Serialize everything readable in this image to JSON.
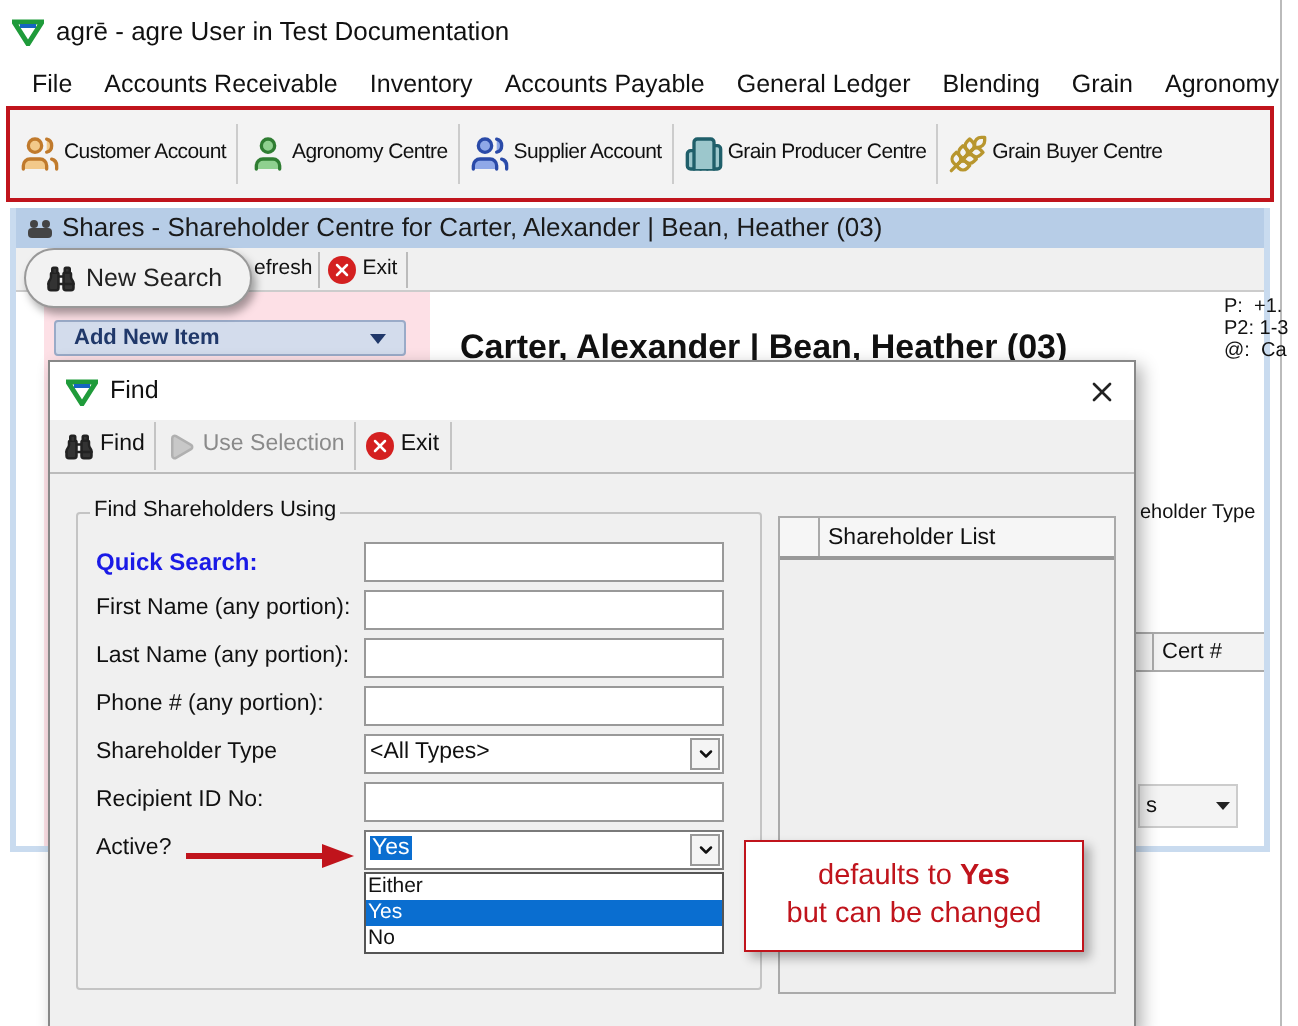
{
  "app": {
    "title": "agrē - agre User in Test Documentation"
  },
  "menu": [
    {
      "label": "File"
    },
    {
      "label": "Accounts Receivable"
    },
    {
      "label": "Inventory"
    },
    {
      "label": "Accounts Payable"
    },
    {
      "label": "General Ledger"
    },
    {
      "label": "Blending"
    },
    {
      "label": "Grain"
    },
    {
      "label": "Agronomy"
    }
  ],
  "toolbar": [
    {
      "label": "Customer Account",
      "kind": "customers"
    },
    {
      "label": "Agronomy Centre",
      "kind": "farmer"
    },
    {
      "label": "Supplier Account",
      "kind": "suppliers"
    },
    {
      "label": "Grain Producer Centre",
      "kind": "producer"
    },
    {
      "label": "Grain Buyer Centre",
      "kind": "buyer"
    }
  ],
  "shares_window": {
    "title": "Shares - Shareholder Centre for Carter, Alexander | Bean, Heather (03)",
    "toolbar": [
      "efresh",
      "Exit"
    ],
    "add_new_item": "Add New Item",
    "heading": "Carter, Alexander | Bean, Heather (03)",
    "contact_lines": [
      "P:  +1.",
      "P2: 1-3",
      "@:  Ca"
    ],
    "column_label": "eholder Type",
    "grid_column": "Cert #",
    "combo_value": "s"
  },
  "new_search": "New Search",
  "find_dialog": {
    "title": "Find",
    "toolbar": [
      {
        "label": "Find",
        "kind": "find",
        "disabled": false
      },
      {
        "label": "Use Selection",
        "kind": "use",
        "disabled": true
      },
      {
        "label": "Exit",
        "kind": "exit",
        "disabled": false
      }
    ],
    "group_title": "Find Shareholders Using",
    "fields": [
      {
        "label": "Quick Search:",
        "kind": "text",
        "emphasis": true
      },
      {
        "label": "First Name (any portion):",
        "kind": "text",
        "emphasis": false
      },
      {
        "label": "Last Name (any portion):",
        "kind": "text",
        "emphasis": false
      },
      {
        "label": "Phone # (any portion):",
        "kind": "text",
        "emphasis": false
      },
      {
        "label": "Shareholder Type",
        "kind": "combo",
        "emphasis": false,
        "value": "<All Types>",
        "expanded": false
      },
      {
        "label": "Recipient ID No:",
        "kind": "text",
        "emphasis": false
      },
      {
        "label": "Active?",
        "kind": "combo",
        "emphasis": false,
        "value": "Yes",
        "expanded": true,
        "options": [
          {
            "label": "Either",
            "selected": false
          },
          {
            "label": "Yes",
            "selected": true
          },
          {
            "label": "No",
            "selected": false
          }
        ]
      }
    ],
    "list_header": "Shareholder List"
  },
  "callout": [
    "defaults to **Yes**",
    "but can be changed"
  ]
}
